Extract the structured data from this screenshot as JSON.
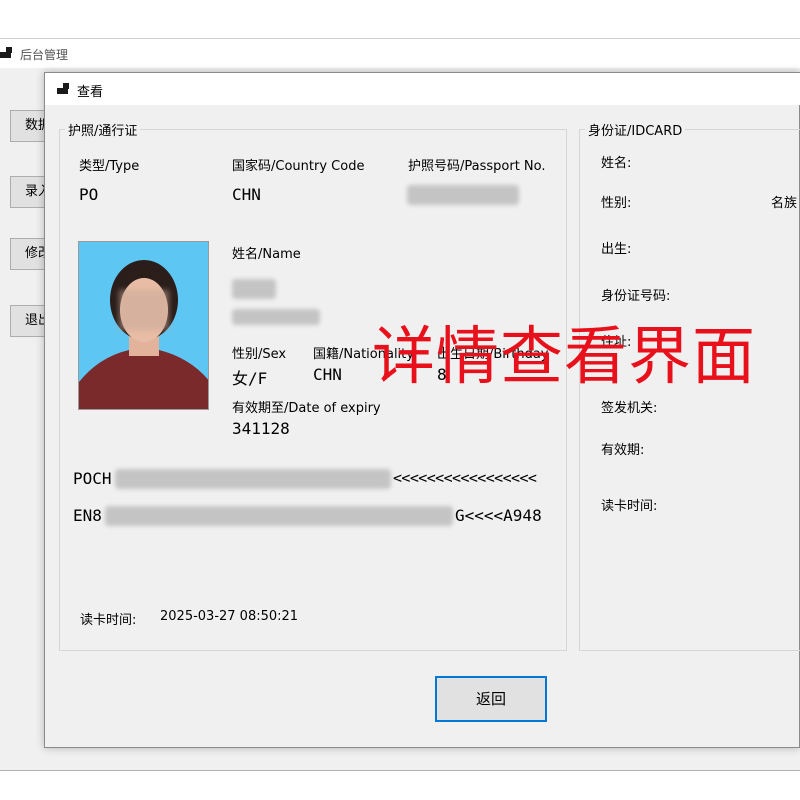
{
  "main_window": {
    "title": "后台管理",
    "side_buttons": [
      "数据",
      "录入",
      "修改",
      "退出"
    ]
  },
  "dialog": {
    "title": "查看",
    "passport_group": {
      "legend": "护照/通行证",
      "type_label": "类型/Type",
      "type_value": "PO",
      "country_label": "国家码/Country Code",
      "country_value": "CHN",
      "passport_no_label": "护照号码/Passport No.",
      "name_label": "姓名/Name",
      "sex_label": "性别/Sex",
      "sex_value": "女/F",
      "nationality_label": "国籍/Nationality",
      "nationality_value": "CHN",
      "birthday_label": "出生日期/Birthday",
      "birthday_value_prefix": "8",
      "expiry_label": "有效期至/Date of expiry",
      "expiry_value": "341128",
      "mrz_line1_start": "POCH",
      "mrz_line1_end": "<<<<<<<<<<<<<<<<<",
      "mrz_line2_start": "EN8",
      "mrz_line2_end": "G<<<<A948",
      "read_time_label": "读卡时间:",
      "read_time_value": "2025-03-27 08:50:21"
    },
    "idcard_group": {
      "legend": "身份证/IDCARD",
      "name_label": "姓名:",
      "sex_label": "性别:",
      "ethnicity_label": "名族",
      "birth_label": "出生:",
      "id_no_label": "身份证号码:",
      "address_label": "住址:",
      "issuer_label": "签发机关:",
      "validity_label": "有效期:",
      "read_time_label": "读卡时间:"
    },
    "return_button": "返回"
  },
  "overlay_caption": "详情查看界面",
  "colors": {
    "dialog_bg": "#f0f0f0",
    "accent": "#0078d7",
    "overlay": "#e8101a",
    "photo_bg": "#5ec6f2"
  }
}
